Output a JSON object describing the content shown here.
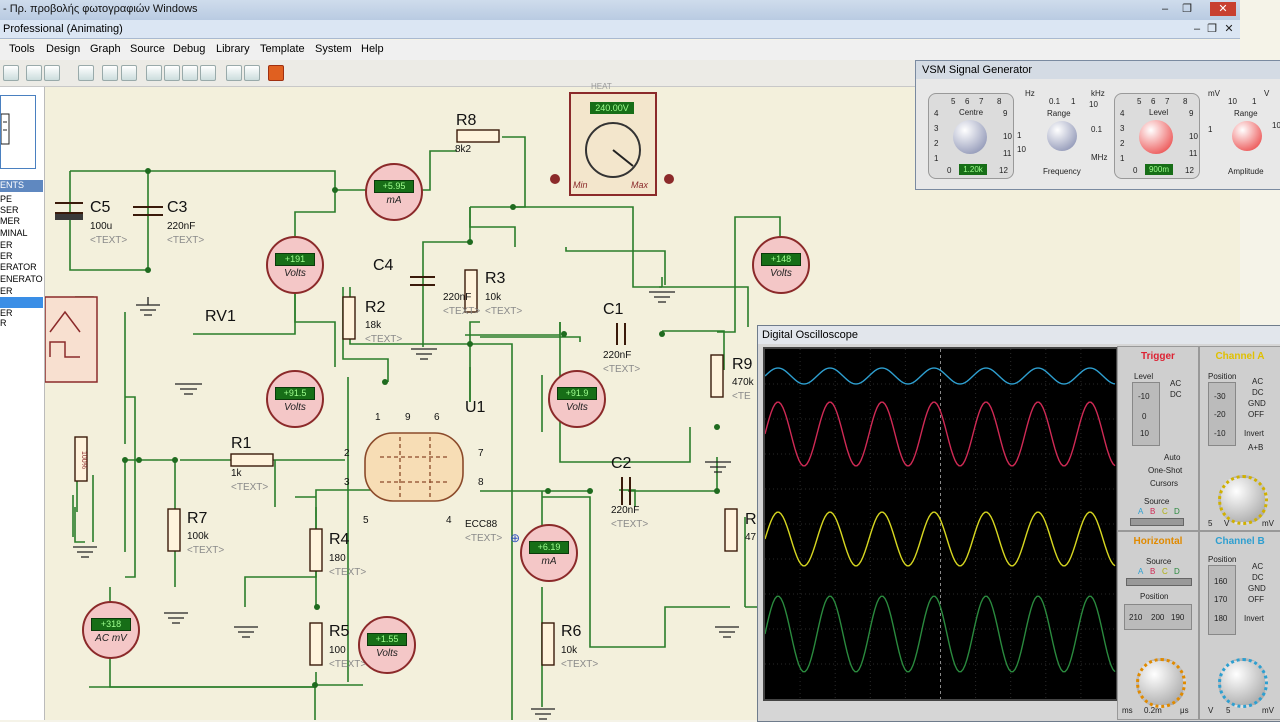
{
  "window": {
    "photo_title": "- Πρ. προβολής φωτογραφιών Windows",
    "app_title": "Professional (Animating)"
  },
  "menu": [
    "Tools",
    "Design",
    "Graph",
    "Source",
    "Debug",
    "Library",
    "Template",
    "System",
    "Help"
  ],
  "left_panel": {
    "header": "ENTS",
    "items": [
      "PE",
      "SER",
      "MER",
      "MINAL",
      "ER",
      "ER",
      "ERATOR",
      "ENERATOR",
      "ER",
      "",
      "ER",
      "R"
    ]
  },
  "schematic": {
    "components": {
      "C5": {
        "ref": "C5",
        "value": "100u",
        "text": "<TEXT>"
      },
      "C3": {
        "ref": "C3",
        "value": "220nF",
        "text": "<TEXT>"
      },
      "C4": {
        "ref": "C4",
        "value": "220nF",
        "text": "<TEXT>"
      },
      "R8": {
        "ref": "R8",
        "value": "8k2"
      },
      "R3": {
        "ref": "R3",
        "value": "10k",
        "text": "<TEXT>"
      },
      "R2": {
        "ref": "R2",
        "value": "18k",
        "text": "<TEXT>"
      },
      "RV1": {
        "ref": "RV1"
      },
      "C1": {
        "ref": "C1",
        "value": "220nF",
        "text": "<TEXT>"
      },
      "R9": {
        "ref": "R9",
        "value": "470k",
        "text": "<TE"
      },
      "U1": {
        "ref": "U1",
        "value": "ECC88",
        "text": "<TEXT>"
      },
      "R1": {
        "ref": "R1",
        "value": "1k",
        "text": "<TEXT>"
      },
      "R7": {
        "ref": "R7",
        "value": "100k",
        "text": "<TEXT>"
      },
      "R4": {
        "ref": "R4",
        "value": "180",
        "text": "<TEXT>"
      },
      "R5": {
        "ref": "R5",
        "value": "100",
        "text": "<TEXT>"
      },
      "C2": {
        "ref": "C2",
        "value": "220nF",
        "text": "<TEXT>"
      },
      "R6": {
        "ref": "R6",
        "value": "10k",
        "text": "<TEXT>"
      },
      "R10": {
        "ref": "R",
        "value": "47"
      }
    },
    "pins": {
      "p1": "1",
      "p9": "9",
      "p6": "6",
      "p2": "2",
      "p7": "7",
      "p3": "3",
      "p8": "8",
      "p5": "5",
      "p4": "4"
    },
    "meters": {
      "ma_top": {
        "reading": "+5.95",
        "unit": "mA"
      },
      "v_191": {
        "reading": "+191",
        "unit": "Volts"
      },
      "v_148": {
        "reading": "+148",
        "unit": "Volts"
      },
      "v_915": {
        "reading": "+91.5",
        "unit": "Volts"
      },
      "v_919": {
        "reading": "+91.9",
        "unit": "Volts"
      },
      "ma_619": {
        "reading": "+6.19",
        "unit": "mA"
      },
      "acmv": {
        "reading": "+318",
        "unit": "AC mV"
      },
      "v_155": {
        "reading": "+1.55",
        "unit": "Volts"
      },
      "side_100": {
        "reading": "100%"
      }
    },
    "voltmeter_big": {
      "reading": "240.00V",
      "min": "Min",
      "max": "Max",
      "tag": "HEAT"
    }
  },
  "siggen": {
    "title": "VSM Signal Generator",
    "centre_label": "Centre",
    "centre_value": "1.20k",
    "centre_scale": [
      "5",
      "6",
      "7",
      "8",
      "4",
      "9",
      "3",
      "10",
      "2",
      "11",
      "1",
      "0",
      "12"
    ],
    "freq_range_label": "Range",
    "freq_range_scale": [
      "0.1",
      "1",
      "10",
      "0.1",
      "1",
      "10",
      "Hz",
      "kHz",
      "MHz"
    ],
    "frequency_label": "Frequency",
    "level_label": "Level",
    "level_value": "900m",
    "level_scale": [
      "5",
      "6",
      "7",
      "8",
      "4",
      "9",
      "3",
      "10",
      "2",
      "11",
      "1",
      "0",
      "12"
    ],
    "amp_range_label": "Range",
    "amp_range_scale": [
      "10",
      "1",
      "10",
      "1",
      "mV",
      "V"
    ],
    "amplitude_label": "Amplitude"
  },
  "scope": {
    "title": "Digital Oscilloscope",
    "trigger_title": "Trigger",
    "trigger": {
      "level": "Level",
      "ac": "AC",
      "dc": "DC",
      "auto": "Auto",
      "oneshot": "One-Shot",
      "cursors": "Cursors",
      "source": "Source",
      "src_abcd": [
        "A",
        "B",
        "C",
        "D"
      ],
      "scale": [
        "-10",
        "0",
        "10"
      ]
    },
    "channel_a": {
      "title": "Channel A",
      "position": "Position",
      "scale": [
        "-30",
        "-20",
        "-10"
      ],
      "opts": [
        "AC",
        "DC",
        "GND",
        "OFF",
        "Invert",
        "A+B"
      ],
      "ticks": [
        "5",
        "V",
        "mV"
      ]
    },
    "horizontal": {
      "title": "Horizontal",
      "source": "Source",
      "position": "Position",
      "position_readout": [
        "210",
        "200",
        "190"
      ],
      "src_abcd": [
        "A",
        "B",
        "C",
        "D"
      ],
      "ticks": [
        "ms",
        "0.2m",
        "μs"
      ]
    },
    "channel_b": {
      "title": "Channel B",
      "position": "Position",
      "scale": [
        "160",
        "170",
        "180"
      ],
      "opts": [
        "AC",
        "DC",
        "GND",
        "OFF",
        "Invert"
      ],
      "ticks": [
        "V",
        "5",
        "mV"
      ]
    },
    "colors": {
      "a": "#2e9fd0",
      "b": "#d02a55",
      "c": "#d6d620",
      "d": "#2a8a3e"
    }
  }
}
